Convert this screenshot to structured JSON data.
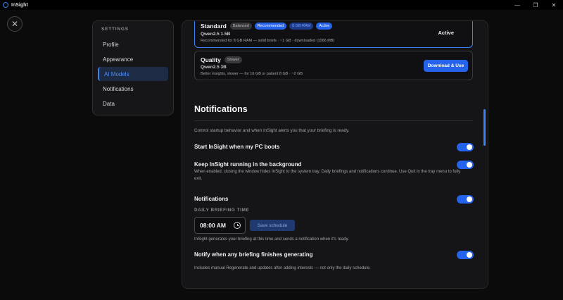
{
  "window": {
    "title": "InSight",
    "controls": [
      "—",
      "❐",
      "✕"
    ]
  },
  "close_glyph": "✕",
  "sidebar": {
    "heading": "SETTINGS",
    "items": [
      {
        "label": "Profile"
      },
      {
        "label": "Appearance"
      },
      {
        "label": "AI Models",
        "active": true
      },
      {
        "label": "Notifications"
      },
      {
        "label": "Data"
      }
    ]
  },
  "models": {
    "standard": {
      "title": "Standard",
      "tags": [
        "Balanced",
        "Recommended",
        "8 GB RAM",
        "Active"
      ],
      "model": "Qwen2.5 1.5B",
      "desc": "Recommended for 8 GB RAM — solid briefs · ~1 GB · downloaded (1066 MB)",
      "status": "Active"
    },
    "quality": {
      "title": "Quality",
      "tags": [
        "Slower"
      ],
      "model": "Qwen2.5 3B",
      "desc": "Better insights, slower — for 16 GB or patient 8 GB · ~2 GB",
      "button": "Download & Use"
    }
  },
  "notifications": {
    "title": "Notifications",
    "desc": "Control startup behavior and when InSight alerts you that your briefing is ready.",
    "settings": [
      {
        "title": "Start InSight when my PC boots",
        "on": true
      },
      {
        "title": "Keep InSight running in the background",
        "desc": "When enabled, closing the window hides InSight to the system tray. Daily briefings and notifications continue. Use Quit in the tray menu to fully exit.",
        "on": true
      },
      {
        "title": "Notifications",
        "on": true
      },
      {
        "title": "Notify when any briefing finishes generating",
        "desc": "Includes manual Regenerate and updates after adding interests — not only the daily schedule.",
        "on": true
      }
    ],
    "briefing_time": {
      "label": "DAILY BRIEFING TIME",
      "value": "08:00 AM",
      "save_label": "Save schedule",
      "help": "InSight generates your briefing at this time and sends a notification when it's ready."
    }
  },
  "colors": {
    "accent": "#2563eb",
    "background": "#0b0b0c",
    "panel": "#151517"
  }
}
